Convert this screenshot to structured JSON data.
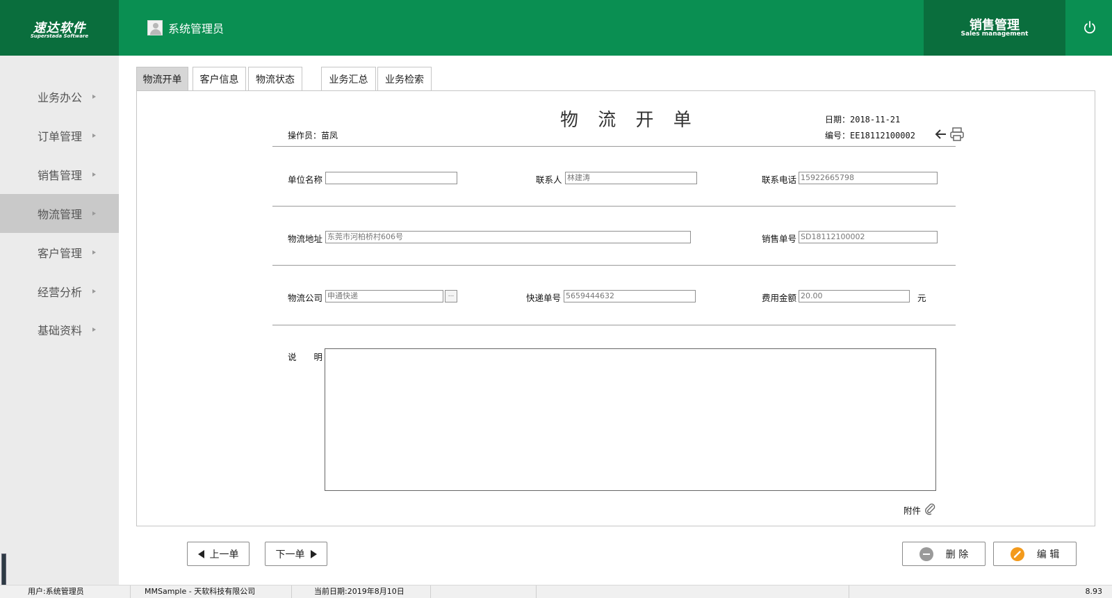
{
  "header": {
    "logo_cn": "速达软件",
    "logo_en": "Superstada Software",
    "user_name": "系统管理员",
    "module_cn": "销售管理",
    "module_en": "Sales management"
  },
  "sidebar": {
    "items": [
      {
        "label": "业务办公"
      },
      {
        "label": "订单管理"
      },
      {
        "label": "销售管理"
      },
      {
        "label": "物流管理",
        "active": true
      },
      {
        "label": "客户管理"
      },
      {
        "label": "经营分析"
      },
      {
        "label": "基础资料"
      }
    ]
  },
  "tabs": [
    {
      "label": "物流开单",
      "active": true
    },
    {
      "label": "客户信息"
    },
    {
      "label": "物流状态"
    },
    {
      "label": "业务汇总"
    },
    {
      "label": "业务检索"
    }
  ],
  "form": {
    "title": "物 流 开 单",
    "operator": "操作员：苗凤",
    "date": "日期：2018-11-21",
    "number": "编号：EE18112100002",
    "labels": {
      "unit_name": "单位名称",
      "contact": "联系人",
      "phone": "联系电话",
      "address": "物流地址",
      "sales_no": "销售单号",
      "company": "物流公司",
      "express_no": "快递单号",
      "fee": "费用金额",
      "yuan": "元",
      "desc": "说　　明",
      "attach": "附件"
    },
    "values": {
      "unit_name": "",
      "contact": "林建涛",
      "phone": "15922665798",
      "address": "东莞市河柏桥村606号",
      "sales_no": "SD18112100002",
      "company": "申通快递",
      "company_btn": "...",
      "express_no": "5659444632",
      "fee": "20.00",
      "desc": ""
    }
  },
  "buttons": {
    "prev": "上一单",
    "next": "下一单",
    "delete": "删 除",
    "edit": "编 辑"
  },
  "status": {
    "user": "用户:系统管理员",
    "app": "MMSample - 天软科技有限公司",
    "date": "当前日期:2019年8月10日",
    "version": "8.93"
  }
}
